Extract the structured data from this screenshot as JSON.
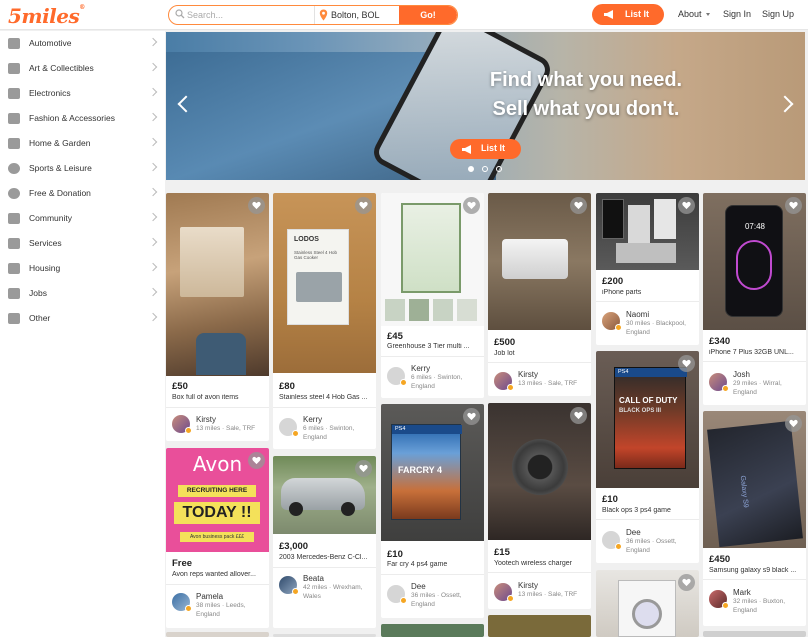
{
  "header": {
    "logo": "5miles",
    "search_placeholder": "Search...",
    "location": "Bolton, BOL",
    "go_label": "Go!",
    "list_it_label": "List It",
    "about_label": "About",
    "sign_in_label": "Sign In",
    "sign_up_label": "Sign Up",
    "accent_color": "#ff6a2b"
  },
  "sidebar": {
    "items": [
      {
        "label": "Automotive",
        "icon": "car-icon"
      },
      {
        "label": "Art & Collectibles",
        "icon": "art-icon"
      },
      {
        "label": "Electronics",
        "icon": "tv-icon"
      },
      {
        "label": "Fashion & Accessories",
        "icon": "shirt-icon"
      },
      {
        "label": "Home & Garden",
        "icon": "home-icon"
      },
      {
        "label": "Sports & Leisure",
        "icon": "ball-icon"
      },
      {
        "label": "Free & Donation",
        "icon": "free-icon"
      },
      {
        "label": "Community",
        "icon": "people-icon"
      },
      {
        "label": "Services",
        "icon": "handshake-icon"
      },
      {
        "label": "Housing",
        "icon": "building-icon"
      },
      {
        "label": "Jobs",
        "icon": "briefcase-icon"
      },
      {
        "label": "Other",
        "icon": "layers-icon"
      }
    ]
  },
  "hero": {
    "headline_1": "Find what you need.",
    "headline_2": "Sell what you don't.",
    "button_label": "List It"
  },
  "cards": [
    {
      "price": "£50",
      "title": "Box full of avon items",
      "seller": "Kirsty",
      "dist": "13 miles · Sale, TRF"
    },
    {
      "price": "Free",
      "title": "Avon reps wanted allover...",
      "seller": "Pamela",
      "dist": "38 miles · Leeds, England",
      "img_text": [
        "Avon",
        "RECRUITING HERE",
        "TODAY !!",
        "Avon business pack £££"
      ]
    },
    {
      "price": "£80",
      "title": "Stainless steel 4 Hob Gas ...",
      "seller": "Kerry",
      "dist": "6 miles · Swinton, England",
      "img_text": [
        "LODOS",
        "Stainless Steel 4 Hob Gas Cooker"
      ]
    },
    {
      "price": "£3,000",
      "title": "2003 Mercedes-Benz C-Cl...",
      "seller": "Beata",
      "dist": "42 miles · Wrexham, Wales"
    },
    {
      "price": "£45",
      "title": "Greenhouse 3 Tier multi ...",
      "seller": "Kerry",
      "dist": "6 miles · Swinton, England"
    },
    {
      "price": "£10",
      "title": "Far cry 4 ps4 game",
      "seller": "Dee",
      "dist": "36 miles · Ossett, England",
      "img_text": [
        "PS4",
        "FARCRY 4"
      ]
    },
    {
      "price": "£500",
      "title": "Job lot",
      "seller": "Kirsty",
      "dist": "13 miles · Sale, TRF"
    },
    {
      "price": "£15",
      "title": "Yootech wireless charger",
      "seller": "Kirsty",
      "dist": "13 miles · Sale, TRF"
    },
    {
      "price": "£200",
      "title": "iPhone parts",
      "seller": "Naomi",
      "dist": "30 miles · Blackpool, England"
    },
    {
      "price": "£10",
      "title": "Black ops 3 ps4 game",
      "seller": "Dee",
      "dist": "36 miles · Ossett, England",
      "img_text": [
        "PS4",
        "CALL OF DUTY",
        "BLACK OPS III"
      ]
    },
    {
      "price": "£340",
      "title": "iPhone 7 Plus 32GB UNL...",
      "seller": "Josh",
      "dist": "29 miles · Wirral, England",
      "img_text": [
        "07:48"
      ]
    },
    {
      "price": "£450",
      "title": "Samsung galaxy s9 black ...",
      "seller": "Mark",
      "dist": "32 miles · Buxton, England",
      "img_text": [
        "Galaxy S9"
      ]
    }
  ]
}
